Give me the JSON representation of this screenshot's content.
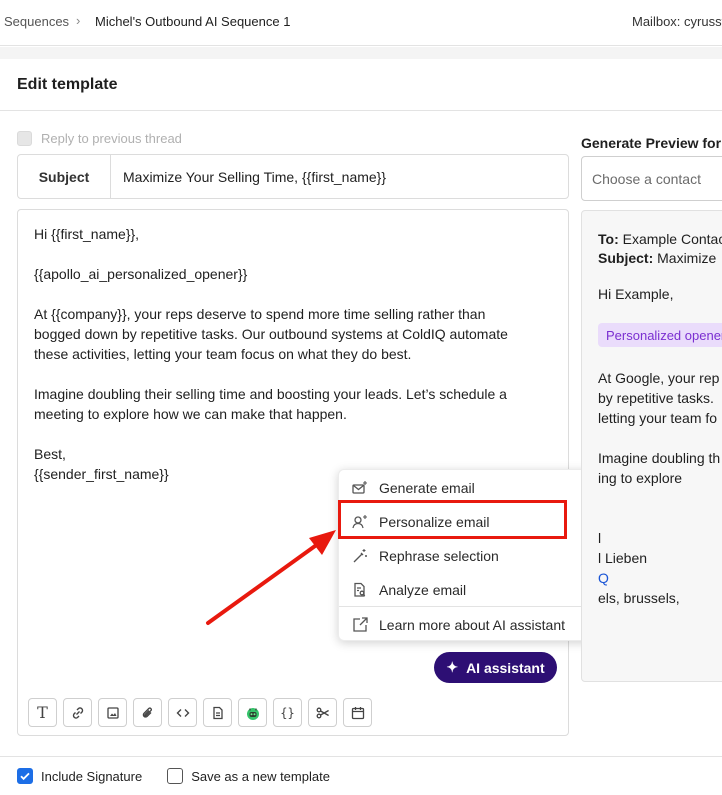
{
  "breadcrumb": {
    "root": "Sequences",
    "separator": "›",
    "current": "Michel's Outbound AI Sequence 1"
  },
  "mailbox": "Mailbox: cyrusst",
  "page_title": "Edit template",
  "reply_to_previous": {
    "label": "Reply to previous thread",
    "checked": false
  },
  "subject": {
    "label": "Subject",
    "value": "Maximize Your Selling Time, {{first_name}}"
  },
  "body": {
    "greeting": "Hi {{first_name}},",
    "opener": "{{apollo_ai_personalized_opener}}",
    "paragraph1_l1": "At {{company}}, your reps deserve to spend more time selling rather than",
    "paragraph1_l2": "bogged down by repetitive tasks. Our outbound systems at ColdIQ automate",
    "paragraph1_l3": "these activities, letting your team focus on what they do best.",
    "paragraph2_l1": "Imagine doubling their selling time and boosting your leads. Let’s schedule a",
    "paragraph2_l2": "meeting to explore how we can make that happen.",
    "signoff": "Best,",
    "signature_var": "{{sender_first_name}}"
  },
  "ai_menu": {
    "items": [
      {
        "label": "Generate email",
        "icon": "mail-sparkle-icon"
      },
      {
        "label": "Personalize email",
        "icon": "user-sparkle-icon"
      },
      {
        "label": "Rephrase selection",
        "icon": "magic-wand-icon"
      },
      {
        "label": "Analyze email",
        "icon": "document-search-icon"
      }
    ],
    "footer_item": {
      "label": "Learn more about AI assistant",
      "icon": "external-link-icon"
    }
  },
  "ai_button": {
    "label": "AI assistant",
    "icon": "sparkle-icon"
  },
  "toolbar": [
    "text-format-icon",
    "link-icon",
    "image-icon",
    "attachment-icon",
    "code-icon",
    "document-icon",
    "robot-icon",
    "variables-icon",
    "scissors-icon",
    "calendar-icon"
  ],
  "preview": {
    "title": "Generate Preview for",
    "contact_placeholder": "Choose a contact",
    "to_label": "To:",
    "to_value": "Example Contac",
    "subject_label": "Subject:",
    "subject_value": "Maximize",
    "greeting": "Hi Example,",
    "badge": "Personalized opener",
    "p1_l1": "At Google, your rep",
    "p1_l2": "by repetitive tasks.",
    "p1_l3": "letting your team fo",
    "p2_l1": "Imagine doubling th",
    "p2_l2": "ing to explore",
    "sig_l1": "l",
    "sig_l2": "l Lieben",
    "sig_l3": "Q",
    "sig_l4": "els, brussels,"
  },
  "footer": {
    "include_signature": {
      "label": "Include Signature",
      "checked": true
    },
    "save_template": {
      "label": "Save as a new template",
      "checked": false
    }
  },
  "colors": {
    "ai_button": "#2d0f74",
    "highlight": "#e8190e",
    "checkbox_on": "#1d6ee6",
    "badge_bg": "#eadcfb",
    "badge_text": "#7b2fd1"
  }
}
